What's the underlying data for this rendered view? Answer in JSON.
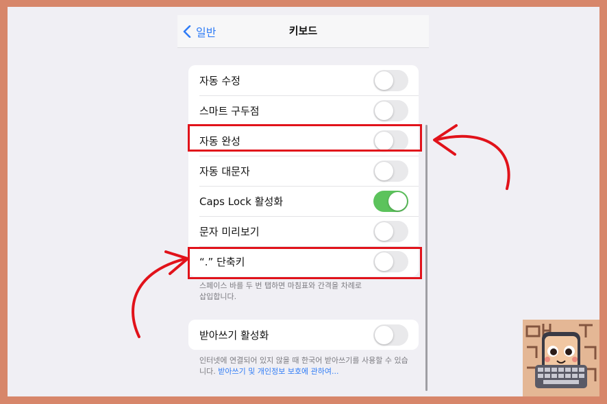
{
  "nav": {
    "back_label": "일반",
    "title": "키보드"
  },
  "group1": {
    "rows": [
      {
        "label": "자동 수정",
        "on": false
      },
      {
        "label": "스마트 구두점",
        "on": false
      },
      {
        "label": "자동 완성",
        "on": false
      },
      {
        "label": "자동 대문자",
        "on": false
      },
      {
        "label": "Caps Lock 활성화",
        "on": true
      },
      {
        "label": "문자 미리보기",
        "on": false
      },
      {
        "label": "“.” 단축키",
        "on": false
      }
    ],
    "footer": "스페이스 바를 두 번 탭하면 마침표와 간격을 차례로 삽입합니다."
  },
  "group2": {
    "rows": [
      {
        "label": "받아쓰기 활성화",
        "on": false
      }
    ],
    "footer_text": "인터넷에 연결되어 있지 않을 때 한국어 받아쓰기를 사용할 수 있습니다.",
    "footer_link": "받아쓰기 및 개인정보 보호에 관하여..."
  },
  "colors": {
    "accent": "#2f7cf6",
    "toggle_on": "#5cc35c",
    "highlight": "#e1121a",
    "frame": "#d7866a"
  }
}
